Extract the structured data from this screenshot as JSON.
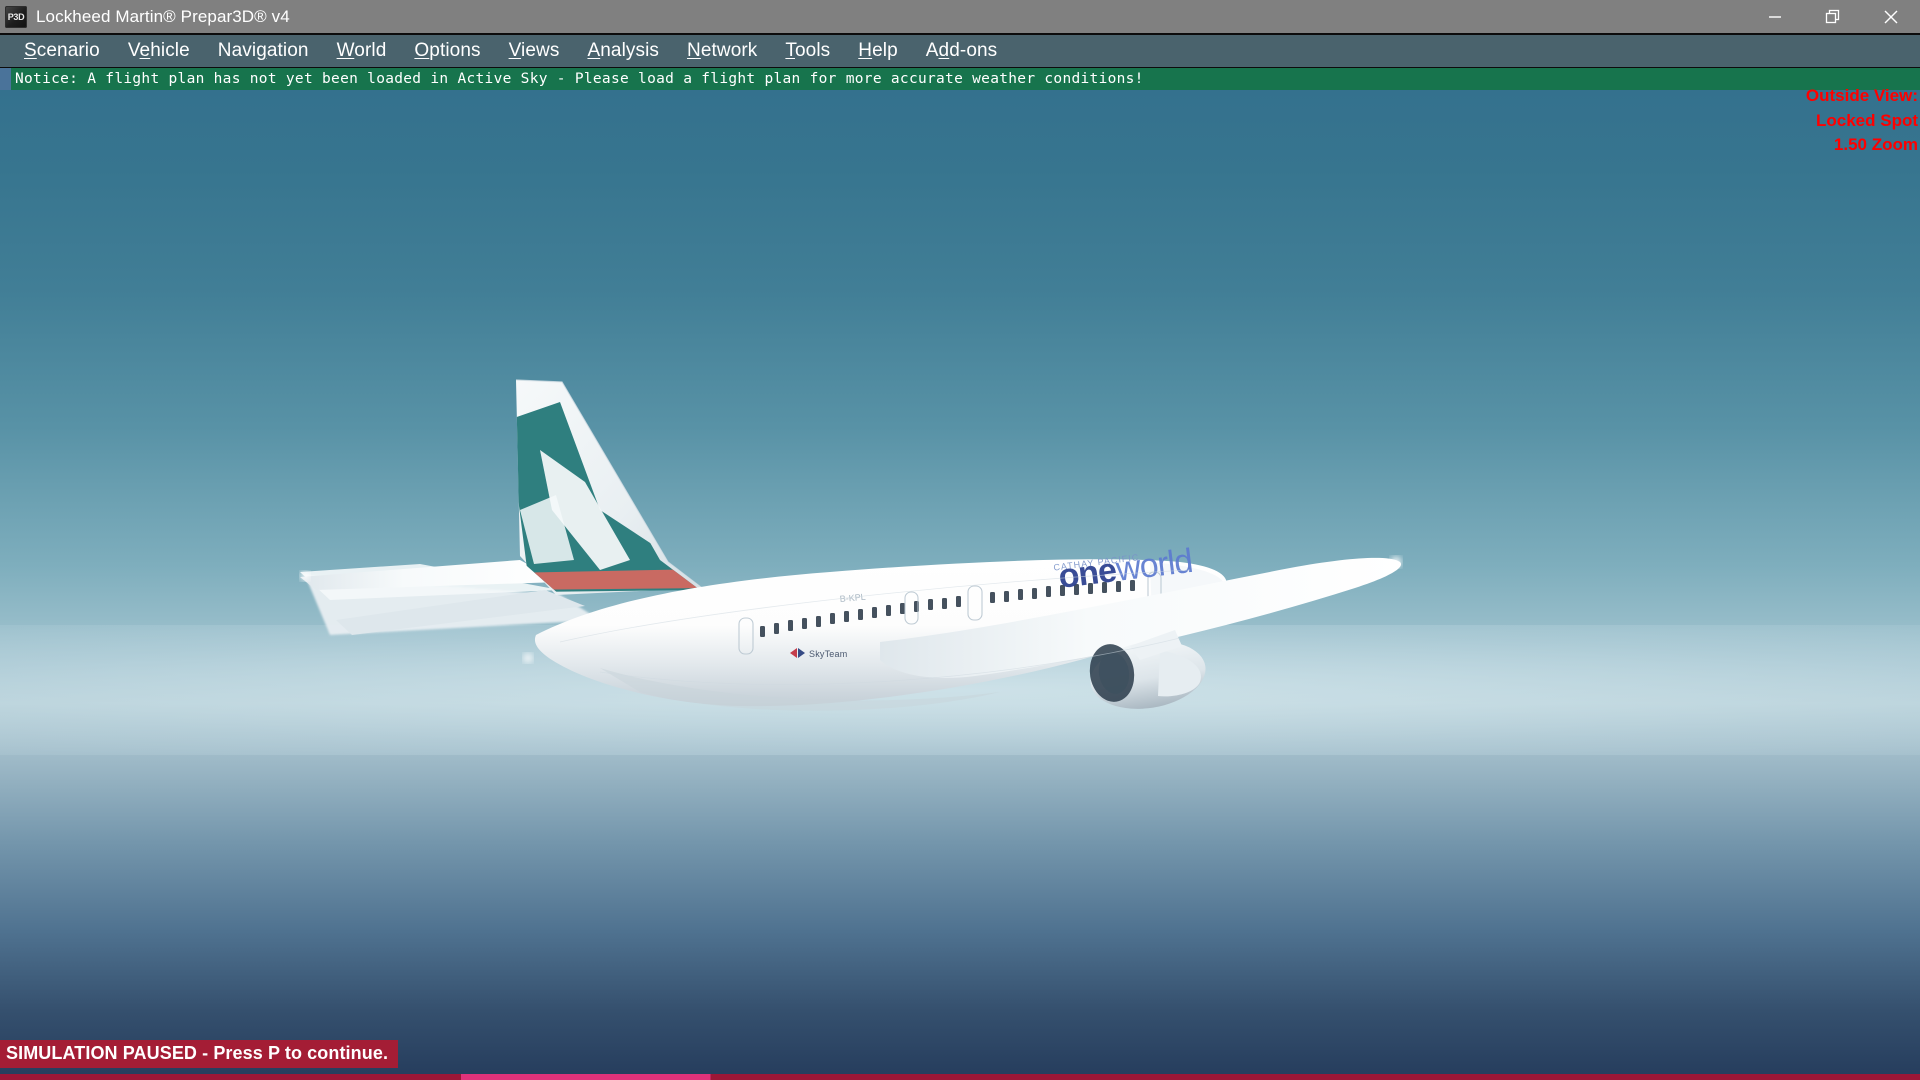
{
  "window": {
    "title": "Lockheed Martin® Prepar3D® v4",
    "app_icon": "P3D",
    "controls": {
      "minimize": "minimize-icon",
      "restore": "restore-icon",
      "close": "close-icon"
    }
  },
  "menubar": {
    "items": [
      {
        "label": "Scenario",
        "accel": "S"
      },
      {
        "label": "Vehicle",
        "accel": "e"
      },
      {
        "label": "Navigation",
        "accel": "g"
      },
      {
        "label": "World",
        "accel": "W"
      },
      {
        "label": "Options",
        "accel": "O"
      },
      {
        "label": "Views",
        "accel": "V"
      },
      {
        "label": "Analysis",
        "accel": "A"
      },
      {
        "label": "Network",
        "accel": "N"
      },
      {
        "label": "Tools",
        "accel": "T"
      },
      {
        "label": "Help",
        "accel": "H"
      },
      {
        "label": "Add-ons",
        "accel": "d"
      }
    ]
  },
  "notice": {
    "text": "Notice: A flight plan has not yet been loaded in Active Sky - Please load a flight plan for more accurate weather conditions!",
    "background_color": "#17744d",
    "text_color": "#ffffff"
  },
  "hud": {
    "color": "#ff0000",
    "lines": [
      "Outside View:",
      "Locked Spot",
      "1.50 Zoom"
    ],
    "view_mode": "Outside View:",
    "camera": "Locked Spot",
    "zoom": "1.50 Zoom"
  },
  "status": {
    "paused_message": "SIMULATION PAUSED - Press P to continue.",
    "paused_bg": "#a41d35",
    "paused_fg": "#ffffff"
  },
  "scene": {
    "description": "Cathay Pacific Boeing 777 in oneworld livery flying above haze layer",
    "livery_text": "oneworld",
    "alliance_badge": "SkyTeam",
    "sky_top_color": "#34718e",
    "haze_color": "#b7d0d8",
    "sky_bottom_color": "#253c5c",
    "tail_teal": "#2f7f7f",
    "tail_red_stripe": "#c96a62",
    "fuselage_color": "#ffffff",
    "oneworld_text_color": "#2b3f8f"
  }
}
